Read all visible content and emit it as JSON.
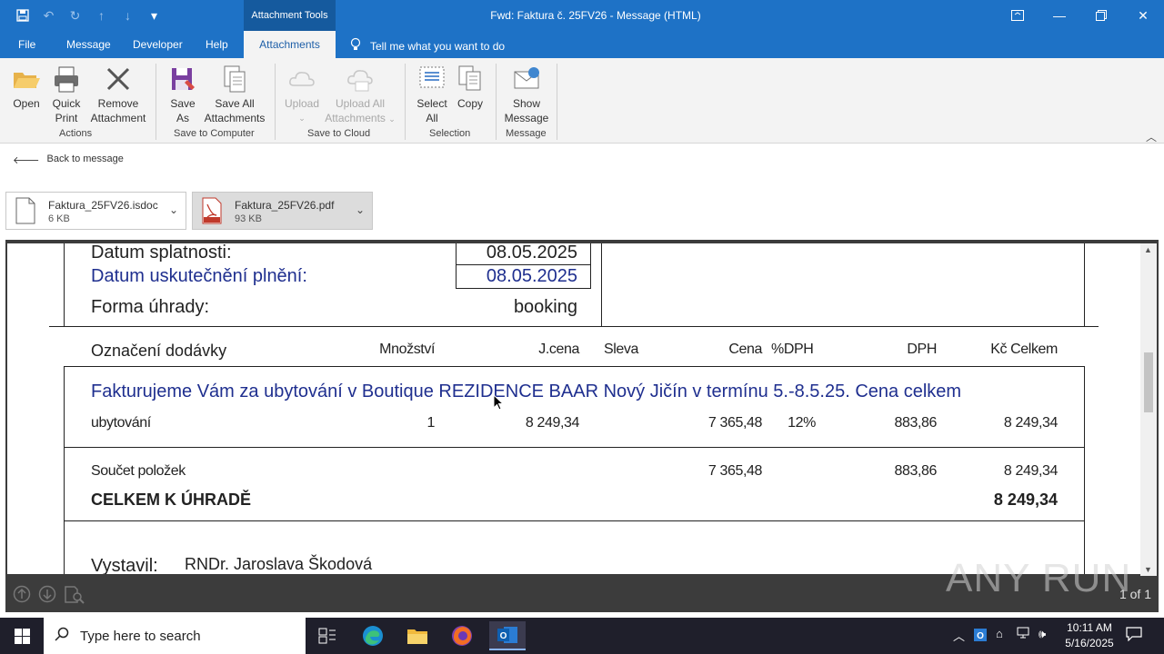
{
  "window": {
    "title": "Fwd: Faktura č. 25FV26  -  Message (HTML)",
    "context_tab": "Attachment Tools"
  },
  "menu": {
    "file": "File",
    "message": "Message",
    "developer": "Developer",
    "help": "Help",
    "attachments": "Attachments",
    "tell_me": "Tell me what you want to do"
  },
  "ribbon": {
    "open": "Open",
    "quick_print_1": "Quick",
    "quick_print_2": "Print",
    "remove_1": "Remove",
    "remove_2": "Attachment",
    "group_actions": "Actions",
    "save_as_1": "Save",
    "save_as_2": "As",
    "save_all_1": "Save All",
    "save_all_2": "Attachments",
    "group_save_computer": "Save to Computer",
    "upload": "Upload",
    "upload_all_1": "Upload All",
    "upload_all_2": "Attachments",
    "group_save_cloud": "Save to Cloud",
    "select_all_1": "Select",
    "select_all_2": "All",
    "copy": "Copy",
    "group_selection": "Selection",
    "show_message_1": "Show",
    "show_message_2": "Message",
    "group_message": "Message"
  },
  "back_link": "Back to message",
  "attachments": [
    {
      "name": "Faktura_25FV26.isdoc",
      "size": "6 KB"
    },
    {
      "name": "Faktura_25FV26.pdf",
      "size": "93 KB"
    }
  ],
  "invoice": {
    "due_label": "Datum splatnosti:",
    "due_value": "08.05.2025",
    "perf_label": "Datum uskutečnění plnění:",
    "perf_value": "08.05.2025",
    "payment_label": "Forma úhrady:",
    "payment_value": "booking",
    "headers": {
      "item": "Označení dodávky",
      "qty": "Množství",
      "unit_price": "J.cena",
      "discount": "Sleva",
      "price": "Cena",
      "vat_pct": "%DPH",
      "vat": "DPH",
      "total": "Kč Celkem"
    },
    "description": "Fakturujeme Vám za ubytování v Boutique REZIDENCE BAAR Nový Jičín v termínu 5.-8.5.25. Cena celkem",
    "row": {
      "item": "ubytování",
      "qty": "1",
      "unit_price": "8 249,34",
      "price": "7 365,48",
      "vat_pct": "12%",
      "vat": "883,86",
      "total": "8 249,34"
    },
    "sum": {
      "label": "Součet položek",
      "price": "7 365,48",
      "vat": "883,86",
      "total": "8 249,34"
    },
    "grand_label": "CELKEM K ÚHRADĚ",
    "grand_total": "8 249,34",
    "issuer_label": "Vystavil:",
    "issuer_name": "RNDr. Jaroslava Škodová"
  },
  "pdf": {
    "page": "1 of 1"
  },
  "watermark": "ANY RUN",
  "taskbar": {
    "search_placeholder": "Type here to search",
    "time": "10:11 AM",
    "date": "5/16/2025"
  }
}
